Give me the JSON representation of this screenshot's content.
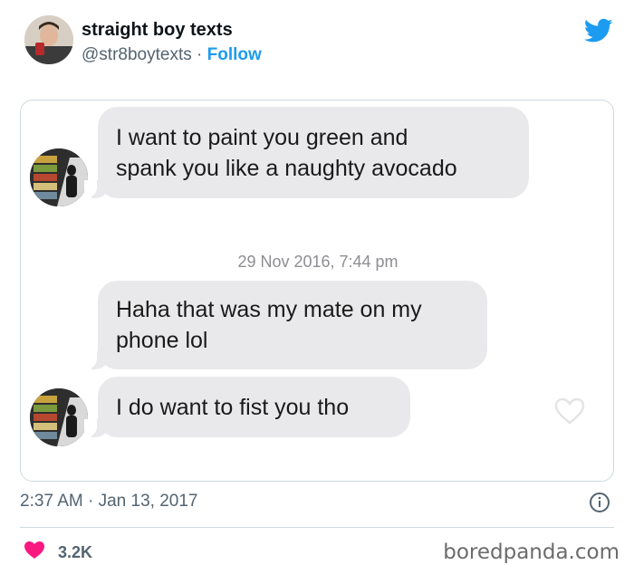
{
  "author": {
    "display_name": "straight boy texts",
    "handle": "@str8boytexts",
    "separator": "·",
    "follow_label": "Follow"
  },
  "icons": {
    "brand": "twitter-bird-icon",
    "like": "heart-icon",
    "info": "info-icon"
  },
  "colors": {
    "twitter_blue": "#1d9bf0",
    "like_red": "#f91880",
    "bubble_gray": "#e9e9eb"
  },
  "conversation": {
    "messages": [
      {
        "lines": [
          "I want to paint you green and",
          "spank you like a naughty avocado"
        ]
      },
      {
        "lines": [
          "Haha that was my mate on my",
          "phone lol"
        ]
      },
      {
        "lines": [
          "I do want to fist you tho"
        ]
      }
    ],
    "timestamp": "29 Nov 2016, 7:44 pm"
  },
  "tweet_meta": {
    "time": "2:37 AM",
    "separator": "·",
    "date": "Jan 13, 2017"
  },
  "engagement": {
    "likes": "3.2K"
  },
  "watermark": "boredpanda.com"
}
